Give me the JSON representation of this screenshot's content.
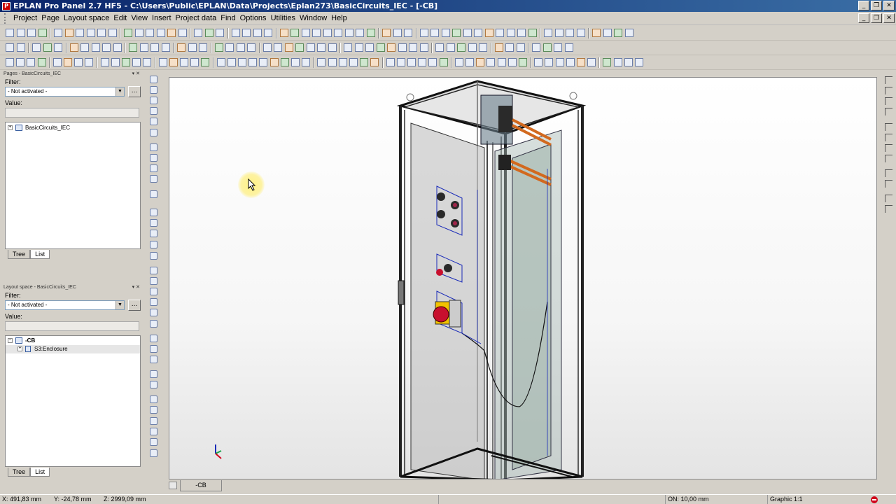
{
  "window": {
    "title": "EPLAN Pro Panel 2.7 HF5 - C:\\Users\\Public\\EPLAN\\Data\\Projects\\Eplan273\\BasicCircuits_IEC - [-CB]",
    "app_icon": "P",
    "controls": [
      "_",
      "❐",
      "✕"
    ]
  },
  "menubar": {
    "items": [
      "Project",
      "Page",
      "Layout space",
      "Edit",
      "View",
      "Insert",
      "Project data",
      "Find",
      "Options",
      "Utilities",
      "Window",
      "Help"
    ],
    "mdi_controls": [
      "_",
      "❐",
      "✕"
    ]
  },
  "pages_panel": {
    "header": "Pages - BasicCircuits_IEC",
    "header_controls": "▾ ✕",
    "filter_label": "Filter:",
    "filter_value": "- Not activated -",
    "filter_more": "...",
    "value_label": "Value:",
    "tree": [
      {
        "label": "BasicCircuits_IEC",
        "expander": "+"
      }
    ],
    "tabs": [
      "Tree",
      "List"
    ]
  },
  "layout_panel": {
    "header": "Layout space - BasicCircuits_IEC",
    "header_controls": "▾ ✕",
    "filter_label": "Filter:",
    "filter_value": "- Not activated -",
    "filter_more": "...",
    "value_label": "Value:",
    "tree": [
      {
        "label": "-CB",
        "expander": "−",
        "bold": true
      },
      {
        "label": "S3:Enclosure",
        "expander": "+"
      }
    ],
    "tabs": [
      "Tree",
      "List"
    ]
  },
  "document_tab": {
    "label": "-CB"
  },
  "statusbar": {
    "x": "X: 491,83 mm",
    "y": "Y: -24,78 mm",
    "z": "Z: 2999,09 mm",
    "grid": "ON: 10,00 mm",
    "graphic": "Graphic 1:1"
  },
  "colors": {
    "title_gradient_start": "#0a246a",
    "title_gradient_end": "#3a6ea5",
    "chrome": "#d4d0c8",
    "wire": "#1a2bb8",
    "busbar": "#d2691e",
    "emergency_stop": "#c8102e",
    "emergency_base": "#f2c200"
  },
  "icons": {
    "cursor": "mouse-pointer-icon",
    "axes": "coordinate-axes-icon",
    "status": "stop-icon"
  }
}
